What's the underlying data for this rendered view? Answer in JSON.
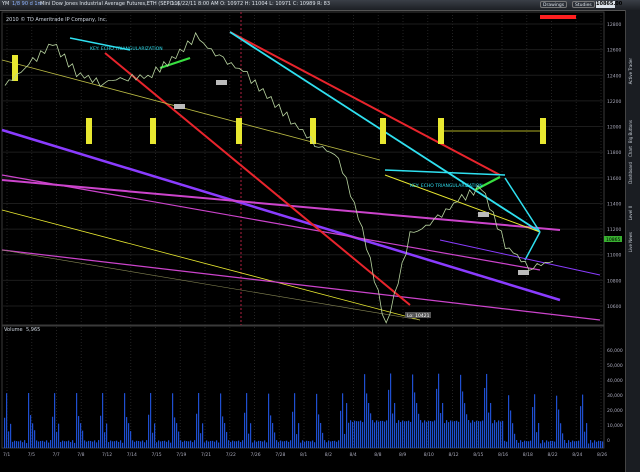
{
  "topbar": {
    "symbol": "YM",
    "timeframe": "1/8 90 d 1m",
    "title": "Mini Dow Jones Industrial Average Futures,ETH (SEP 11)",
    "quote": "D: 6/22/11 8:00 AM  O: 10972  H: 11004  L: 10971  C: 10989  R: 83",
    "buttons": [
      "Drawings",
      "Studies"
    ],
    "price": "10865.00"
  },
  "chart_info": {
    "study_label": "2010 © TD Ameritrade IP Company, Inc.",
    "annotation_top": "KEY: ECHO TRIANGULARIZATION",
    "annotation_mid": "KEY: ECHO TRIANGULARIZATION",
    "low_label": "Lo: 10421",
    "volume_label": "Volume",
    "volume_value": "5,965",
    "last_price_tag": "10865"
  },
  "side_tabs": [
    "Active Trader",
    "Big Buttons",
    "Chart",
    "Dashboard",
    "Level II",
    "Live News"
  ],
  "chart_data": {
    "type": "line",
    "x_ticks": [
      "7/1",
      "7/5",
      "7/7",
      "7/8",
      "7/12",
      "7/14",
      "7/15",
      "7/19",
      "7/21",
      "7/22",
      "7/26",
      "7/28",
      "8/1",
      "8/2",
      "8/4",
      "8/8",
      "8/9",
      "8/10",
      "8/12",
      "8/15",
      "8/16",
      "8/18",
      "8/22",
      "8/24",
      "8/26"
    ],
    "y_ticks": [
      "12800",
      "12600",
      "12400",
      "12200",
      "12000",
      "11800",
      "11600",
      "11400",
      "11200",
      "11000",
      "10800",
      "10600"
    ],
    "volume_ticks": [
      "60,000",
      "50,000",
      "40,000",
      "30,000",
      "20,000",
      "10,000",
      "0"
    ],
    "price_series": [
      {
        "x": 0,
        "y": 12320
      },
      {
        "x": 1,
        "y": 12480
      },
      {
        "x": 2,
        "y": 12650
      },
      {
        "x": 3,
        "y": 12420
      },
      {
        "x": 4,
        "y": 12340
      },
      {
        "x": 5,
        "y": 12380
      },
      {
        "x": 6,
        "y": 12390
      },
      {
        "x": 7,
        "y": 12520
      },
      {
        "x": 8,
        "y": 12700
      },
      {
        "x": 9,
        "y": 12540
      },
      {
        "x": 10,
        "y": 12430
      },
      {
        "x": 11,
        "y": 12240
      },
      {
        "x": 12,
        "y": 12050
      },
      {
        "x": 13,
        "y": 11870
      },
      {
        "x": 14,
        "y": 11760
      },
      {
        "x": 15,
        "y": 11200
      },
      {
        "x": 16,
        "y": 10440
      },
      {
        "x": 17,
        "y": 11150
      },
      {
        "x": 18,
        "y": 11260
      },
      {
        "x": 19,
        "y": 11420
      },
      {
        "x": 20,
        "y": 11530
      },
      {
        "x": 21,
        "y": 11080
      },
      {
        "x": 22,
        "y": 10900
      },
      {
        "x": 23,
        "y": 10950
      }
    ],
    "colors": {
      "price": "#b8d4a0",
      "cyan": "#2fe0f0",
      "red": "#e8242c",
      "purple": "#8a3cff",
      "magenta": "#cc44cc",
      "yellow": "#e8e830",
      "green": "#38e040",
      "volume": "#1f4fd0"
    }
  }
}
